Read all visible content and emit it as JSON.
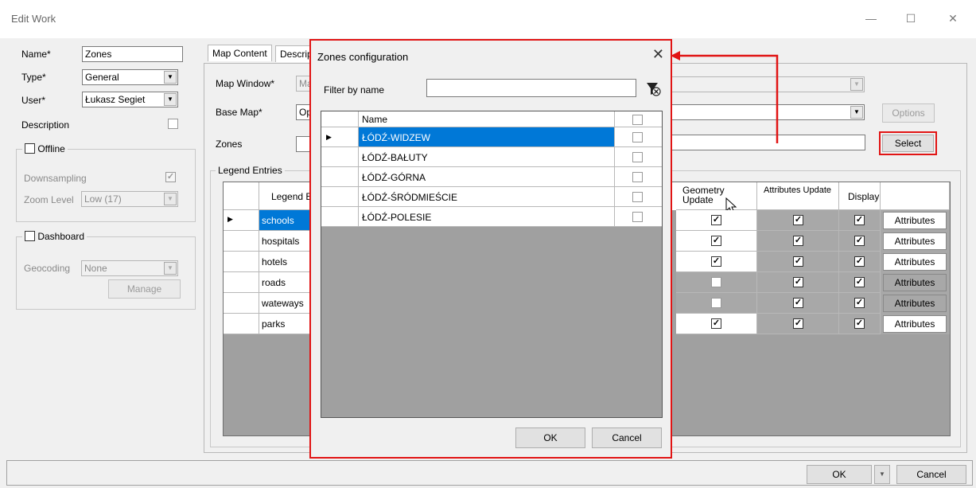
{
  "window": {
    "title": "Edit Work",
    "minimize_glyph": "—",
    "maximize_glyph": "☐",
    "close_glyph": "✕"
  },
  "left_panel": {
    "name_label": "Name*",
    "name_value": "Zones",
    "type_label": "Type*",
    "type_value": "General",
    "user_label": "User*",
    "user_value": "Łukasz Segiet",
    "description_label": "Description",
    "offline_label": "Offline",
    "downsampling_label": "Downsampling",
    "zoom_level_label": "Zoom Level",
    "zoom_level_value": "Low (17)",
    "dashboard_label": "Dashboard",
    "geocoding_label": "Geocoding",
    "geocoding_value": "None",
    "manage_label": "Manage"
  },
  "tabs": {
    "map_content": "Map Content",
    "description": "Description"
  },
  "map_content": {
    "map_window_label": "Map Window*",
    "map_window_value": "Ma",
    "base_map_label": "Base Map*",
    "base_map_value": "Op",
    "zones_label": "Zones",
    "options_label": "Options",
    "select_label": "Select",
    "legend_entries_label": "Legend Entries"
  },
  "legend_table": {
    "col_legend": "Legend E",
    "col_geometry": "Geometry Update",
    "col_attributes": "Attributes Update",
    "col_display": "Display",
    "button_label": "Attributes",
    "rows": [
      {
        "name": "schools",
        "geometry": true,
        "attributes": true,
        "display": true,
        "selected": true,
        "shaded": false
      },
      {
        "name": "hospitals",
        "geometry": true,
        "attributes": true,
        "display": true,
        "selected": false,
        "shaded": false
      },
      {
        "name": "hotels",
        "geometry": true,
        "attributes": true,
        "display": true,
        "selected": false,
        "shaded": false
      },
      {
        "name": "roads",
        "geometry": false,
        "attributes": true,
        "display": true,
        "selected": false,
        "shaded": true
      },
      {
        "name": "wateways",
        "geometry": false,
        "attributes": true,
        "display": true,
        "selected": false,
        "shaded": true
      },
      {
        "name": "parks",
        "geometry": true,
        "attributes": true,
        "display": true,
        "selected": false,
        "shaded": false
      }
    ]
  },
  "dialog": {
    "title": "Zones configuration",
    "filter_label": "Filter by name",
    "filter_value": "",
    "col_name": "Name",
    "ok_label": "OK",
    "cancel_label": "Cancel",
    "rows": [
      {
        "name": "ŁÓDŹ-WIDZEW",
        "checked": false,
        "selected": true
      },
      {
        "name": "ŁÓDŹ-BAŁUTY",
        "checked": false,
        "selected": false
      },
      {
        "name": "ŁÓDŹ-GÓRNA",
        "checked": false,
        "selected": false
      },
      {
        "name": "ŁÓDŹ-ŚRÓDMIEŚCIE",
        "checked": false,
        "selected": false
      },
      {
        "name": "ŁÓDŹ-POLESIE",
        "checked": false,
        "selected": false
      }
    ]
  },
  "footer": {
    "ok_label": "OK",
    "cancel_label": "Cancel"
  },
  "colors": {
    "highlight": "#e11414",
    "selection": "#0078d7"
  }
}
